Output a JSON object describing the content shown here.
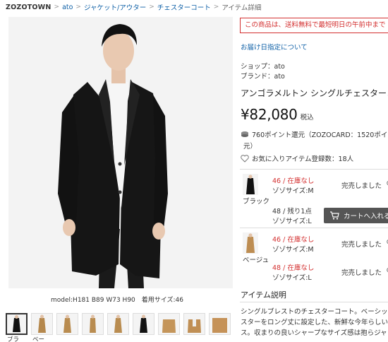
{
  "breadcrumb": {
    "items": [
      "ZOZOTOWN",
      "ato",
      "ジャケット/アウター",
      "チェスターコート"
    ],
    "current": "アイテム詳細"
  },
  "photo": {
    "model_info": "model:H181 B89 W73 H90　着用サイズ:46"
  },
  "thumbnails": {
    "labels": [
      "ブラ",
      "ベー"
    ],
    "count": 9
  },
  "notice": "この商品は、送料無料で最短明日の午前中まで",
  "delivery_link": "お届け日指定について",
  "shop_line": "ショップ：ato",
  "brand_line": "ブランド：ato",
  "product_name": "アンゴラメルトン シングルチェスターコ",
  "price": {
    "amount": "¥82,080",
    "tax": "税込"
  },
  "points": {
    "text": "760ポイント還元（ZOZOCARD：1520ポイ",
    "text2": "元）"
  },
  "favorite": "お気に入りアイテム登録数：18人",
  "variants": [
    {
      "color": "ブラック",
      "rows": [
        {
          "stock": "46 / 在庫なし",
          "size": "ゾゾサイズ:M",
          "status": "完売しました"
        },
        {
          "stock": "48 / 残り1点",
          "size": "ゾゾサイズ:L",
          "cart": "カートへ入れる"
        }
      ]
    },
    {
      "color": "ベージュ",
      "rows": [
        {
          "stock": "46 / 在庫なし",
          "size": "ゾゾサイズ:M",
          "status": "完売しました"
        },
        {
          "stock": "48 / 在庫なし",
          "size": "ゾゾサイズ:L",
          "status": "完売しました"
        }
      ]
    }
  ],
  "description": {
    "title": "アイテム説明",
    "lines": [
      "シングルブレストのチェスターコート。ベーシッ",
      "スターをロング丈に設定した、新鮮な今年らしい",
      "ス。収まりの良いシャープなサイズ感は抱らジャ"
    ]
  },
  "colors": {
    "link": "#0d5fa6",
    "alert": "#d32f2f",
    "button": "#555555"
  }
}
